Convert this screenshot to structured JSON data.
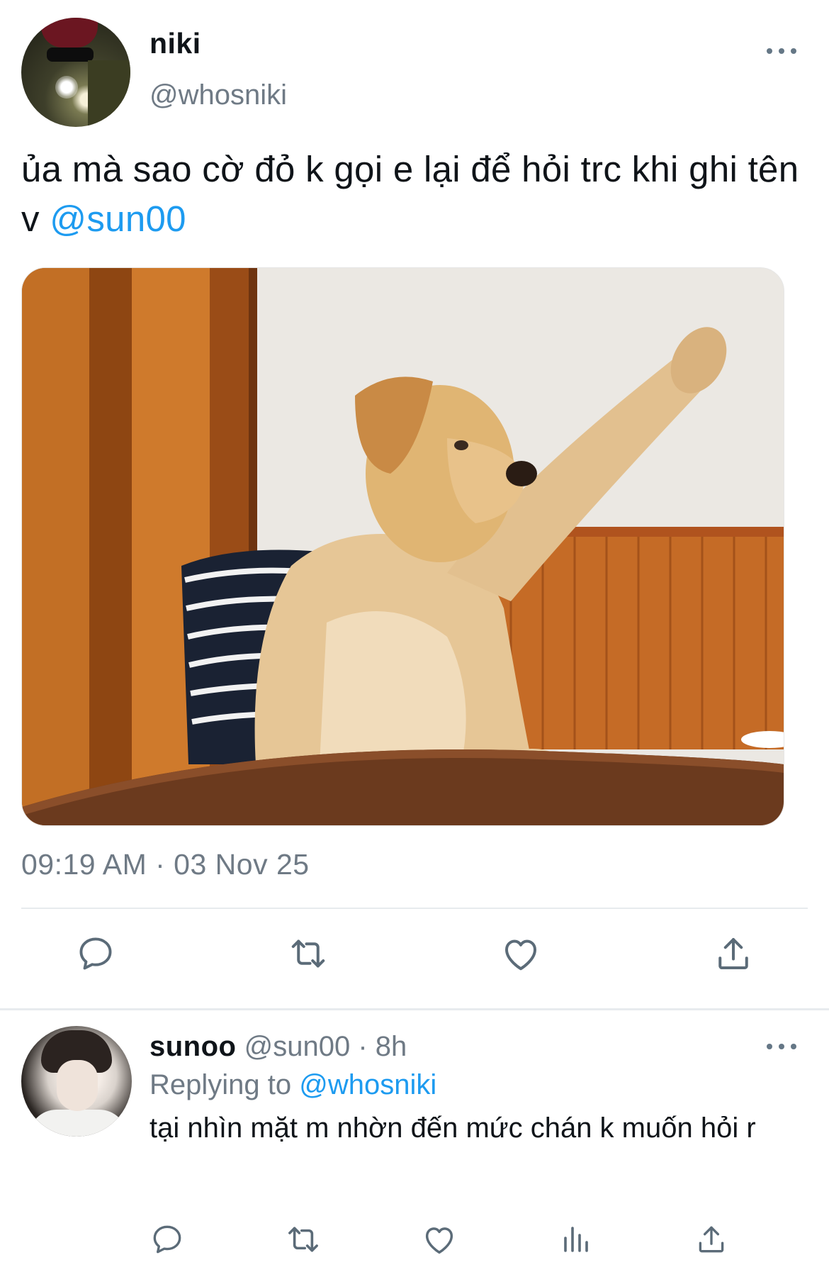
{
  "tweet": {
    "author": {
      "display_name": "niki",
      "handle": "@whosniki"
    },
    "text_main": "ủa mà sao cờ đỏ k gọi e lại để hỏi trc khi ghi tên v ",
    "mention": "@sun00",
    "timestamp": "09:19 AM · 03 Nov 25",
    "actions": [
      "reply-icon",
      "retweet-icon",
      "like-icon",
      "share-icon"
    ]
  },
  "reply": {
    "display_name": "sunoo",
    "handle": "@sun00",
    "separator": " · ",
    "time": "8h",
    "replying_label": "Replying to ",
    "replying_to": "@whosniki",
    "text": "tại nhìn mặt m nhờn đến mức chán k muốn hỏi r",
    "actions": [
      "reply-icon",
      "retweet-icon",
      "like-icon",
      "analytics-icon",
      "share-icon"
    ]
  },
  "colors": {
    "link": "#1d9bf0",
    "secondary_text": "#6f7a85",
    "icon": "#5b6b78",
    "divider": "#e7ebee"
  }
}
